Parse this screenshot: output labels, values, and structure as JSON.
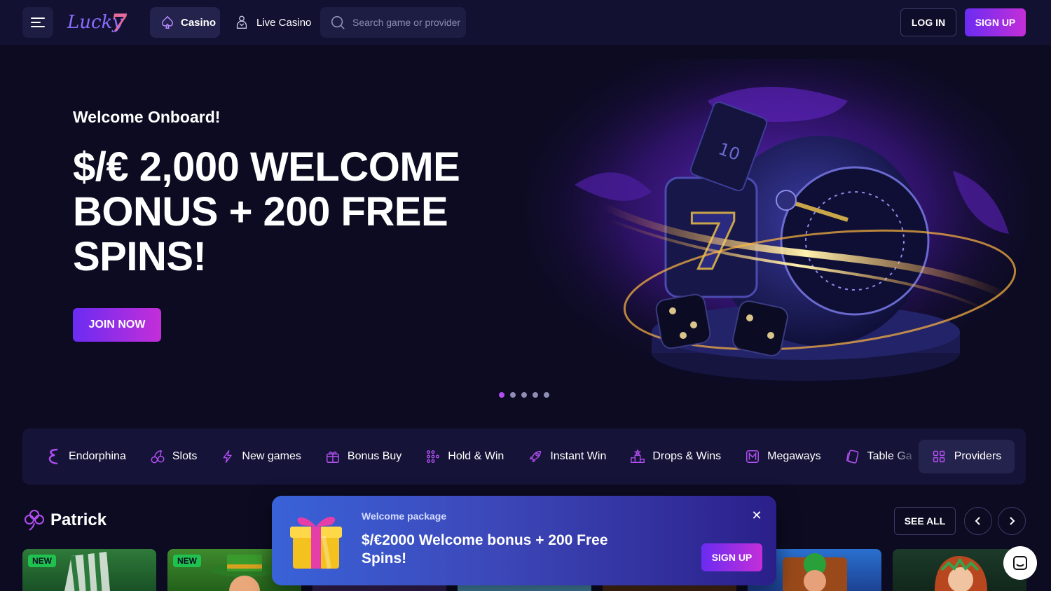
{
  "header": {
    "logo_text": "Lucky7",
    "nav": [
      {
        "label": "Casino",
        "icon": "spade-icon",
        "active": true
      },
      {
        "label": "Live Casino",
        "icon": "dealer-icon",
        "active": false
      }
    ],
    "search_placeholder": "Search game or provider",
    "login_label": "LOG IN",
    "signup_label": "SIGN UP"
  },
  "hero": {
    "eyebrow": "Welcome Onboard!",
    "title": "$/€ 2,000 WELCOME BONUS + 200 FREE SPINS!",
    "cta_label": "JOIN NOW",
    "slides_total": 5,
    "slide_active": 1
  },
  "categories": [
    {
      "label": "Endorphina",
      "icon": "endorphina-icon"
    },
    {
      "label": "Slots",
      "icon": "cherries-icon"
    },
    {
      "label": "New games",
      "icon": "lightning-icon"
    },
    {
      "label": "Bonus Buy",
      "icon": "gift-icon"
    },
    {
      "label": "Hold & Win",
      "icon": "grid-dots-icon"
    },
    {
      "label": "Instant Win",
      "icon": "rocket-icon"
    },
    {
      "label": "Drops & Wins",
      "icon": "podium-icon"
    },
    {
      "label": "Megaways",
      "icon": "megaways-icon"
    },
    {
      "label": "Table Ga",
      "icon": "cards-icon"
    }
  ],
  "providers_label": "Providers",
  "section": {
    "title": "Patrick",
    "icon": "clover-icon",
    "see_all_label": "SEE ALL"
  },
  "games": [
    {
      "badge": "NEW"
    },
    {
      "badge": "NEW"
    },
    {
      "badge": ""
    },
    {
      "badge": ""
    },
    {
      "badge": ""
    },
    {
      "badge": ""
    },
    {
      "badge": ""
    }
  ],
  "popup": {
    "label": "Welcome package",
    "title": "$/€2000 Welcome bonus + 200 Free Spins!",
    "signup_label": "SIGN UP",
    "close_glyph": "✕"
  },
  "colors": {
    "background": "#0c0b22",
    "header": "#121132",
    "accent_gradient_start": "#6a2cf2",
    "accent_gradient_end": "#c42ed8",
    "badge_new": "#20c24f"
  }
}
